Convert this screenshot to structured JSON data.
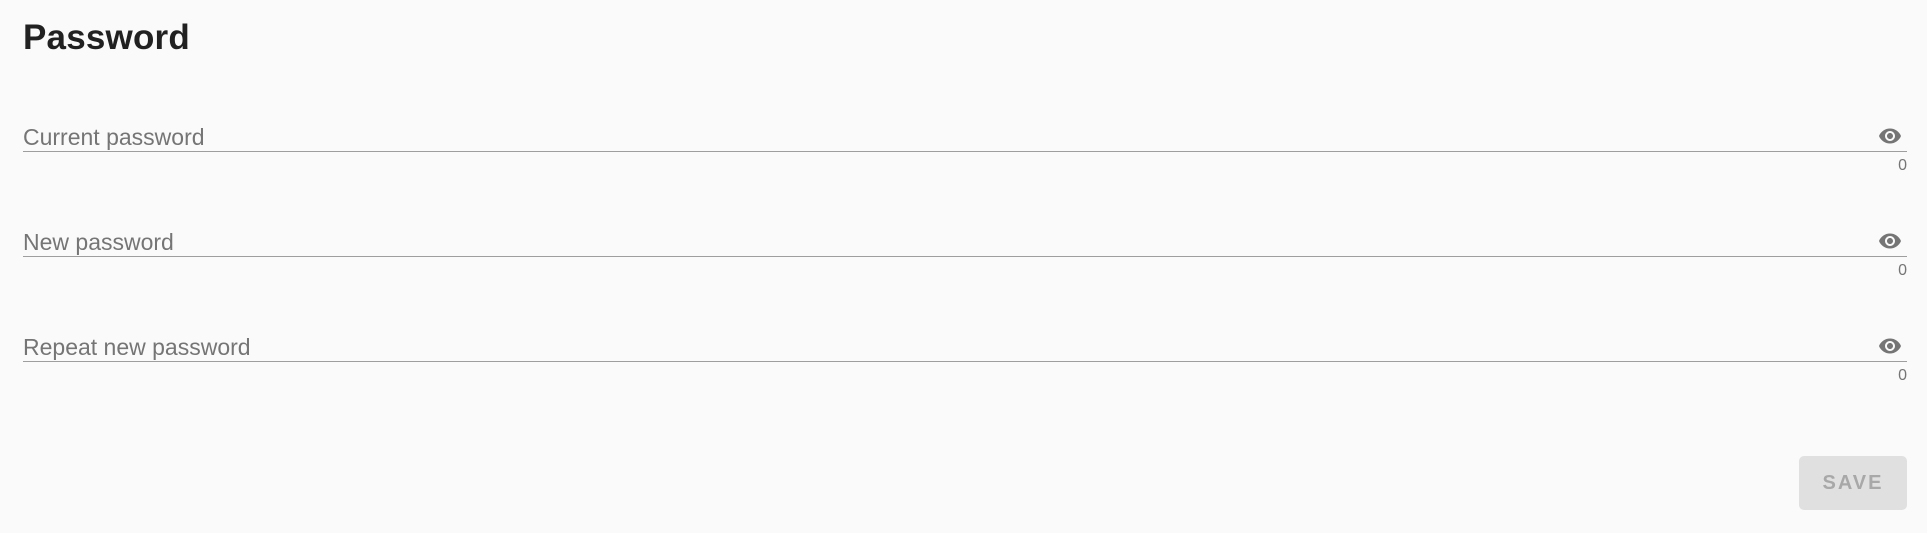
{
  "section": {
    "title": "Password"
  },
  "fields": [
    {
      "placeholder": "Current password",
      "value": "",
      "counter": "0",
      "icon": "eye-icon"
    },
    {
      "placeholder": "New password",
      "value": "",
      "counter": "0",
      "icon": "eye-icon"
    },
    {
      "placeholder": "Repeat new password",
      "value": "",
      "counter": "0",
      "icon": "eye-icon"
    }
  ],
  "actions": {
    "save_label": "SAVE",
    "save_disabled": true
  },
  "colors": {
    "background": "#fafafa",
    "title": "#212121",
    "placeholder": "#757575",
    "underline": "#9e9e9e",
    "icon": "#757575",
    "button_bg_disabled": "#e0e0e0",
    "button_text_disabled": "#a8a8a8"
  }
}
